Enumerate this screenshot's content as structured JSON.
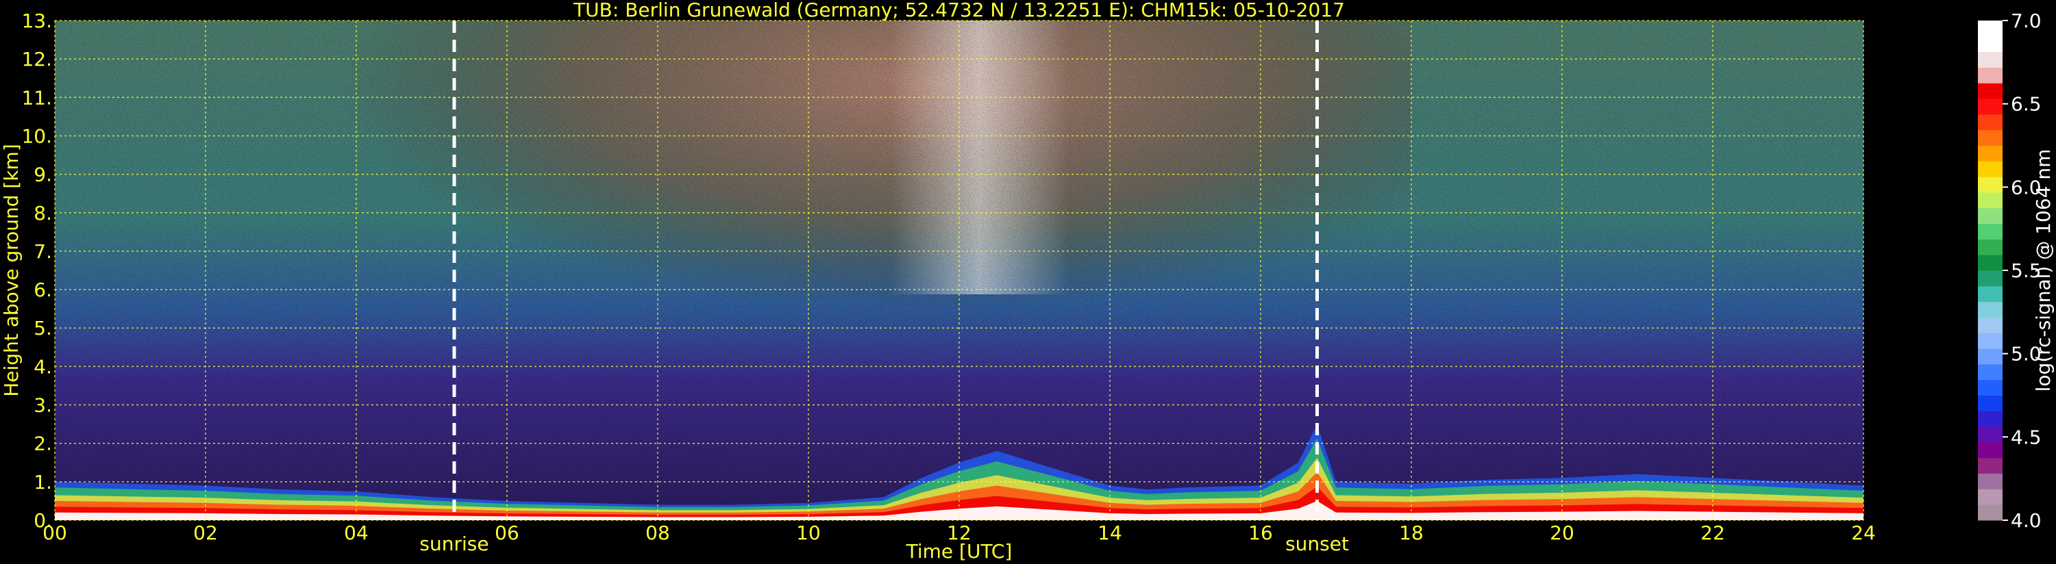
{
  "chart_data": {
    "type": "heatmap",
    "title": "TUB: Berlin Grunewald (Germany; 52.4732 N / 13.2251 E):    CHM15k: 05-10-2017",
    "xlabel": "Time [UTC]",
    "ylabel": "Height above ground [km]",
    "xlim": [
      0,
      24
    ],
    "ylim": [
      0,
      13
    ],
    "x_ticks": [
      "00",
      "02",
      "04",
      "06",
      "08",
      "10",
      "12",
      "14",
      "16",
      "18",
      "20",
      "22",
      "24"
    ],
    "y_ticks": [
      "0.",
      "1.",
      "2.",
      "3.",
      "4.",
      "5.",
      "6.",
      "7.",
      "8.",
      "9.",
      "10.",
      "11.",
      "12.",
      "13."
    ],
    "grid": true,
    "markers": [
      {
        "label": "sunrise",
        "time": 5.3
      },
      {
        "label": "sunset",
        "time": 16.75
      }
    ],
    "colorbar": {
      "label": "log(rc-signal) @ 1064 nm",
      "range": [
        4.0,
        7.0
      ],
      "ticks": [
        "4.0",
        "4.5",
        "5.0",
        "5.5",
        "6.0",
        "6.5",
        "7.0"
      ],
      "colors": [
        "#a890a0",
        "#b898b0",
        "#a070a0",
        "#902880",
        "#800090",
        "#6010b0",
        "#3020d0",
        "#1040f0",
        "#2060ff",
        "#4080ff",
        "#70a0ff",
        "#90b8ff",
        "#a0c8f0",
        "#80d0e0",
        "#40c0b0",
        "#20a070",
        "#109040",
        "#30b050",
        "#50d070",
        "#90e080",
        "#c0f060",
        "#f0f040",
        "#ffd000",
        "#ffa000",
        "#ff7010",
        "#ff4010",
        "#ff1010",
        "#ee0000",
        "#f0b0b0",
        "#f0e0e0",
        "#ffffff",
        "#ffffff"
      ]
    },
    "boundary_layer_top_km": [
      [
        0,
        1.0
      ],
      [
        1,
        0.95
      ],
      [
        2,
        0.9
      ],
      [
        3,
        0.8
      ],
      [
        4,
        0.75
      ],
      [
        5,
        0.6
      ],
      [
        6,
        0.5
      ],
      [
        7,
        0.45
      ],
      [
        8,
        0.4
      ],
      [
        9,
        0.4
      ],
      [
        10,
        0.45
      ],
      [
        11,
        0.6
      ],
      [
        11.5,
        1.1
      ],
      [
        12,
        1.5
      ],
      [
        12.5,
        1.8
      ],
      [
        13,
        1.5
      ],
      [
        13.5,
        1.2
      ],
      [
        14,
        0.9
      ],
      [
        14.5,
        0.8
      ],
      [
        15,
        0.85
      ],
      [
        16,
        0.9
      ],
      [
        16.5,
        1.5
      ],
      [
        16.75,
        2.5
      ],
      [
        17,
        1.0
      ],
      [
        18,
        0.95
      ],
      [
        19,
        1.05
      ],
      [
        20,
        1.1
      ],
      [
        21,
        1.2
      ],
      [
        22,
        1.1
      ],
      [
        23,
        1.0
      ],
      [
        24,
        0.9
      ]
    ]
  }
}
